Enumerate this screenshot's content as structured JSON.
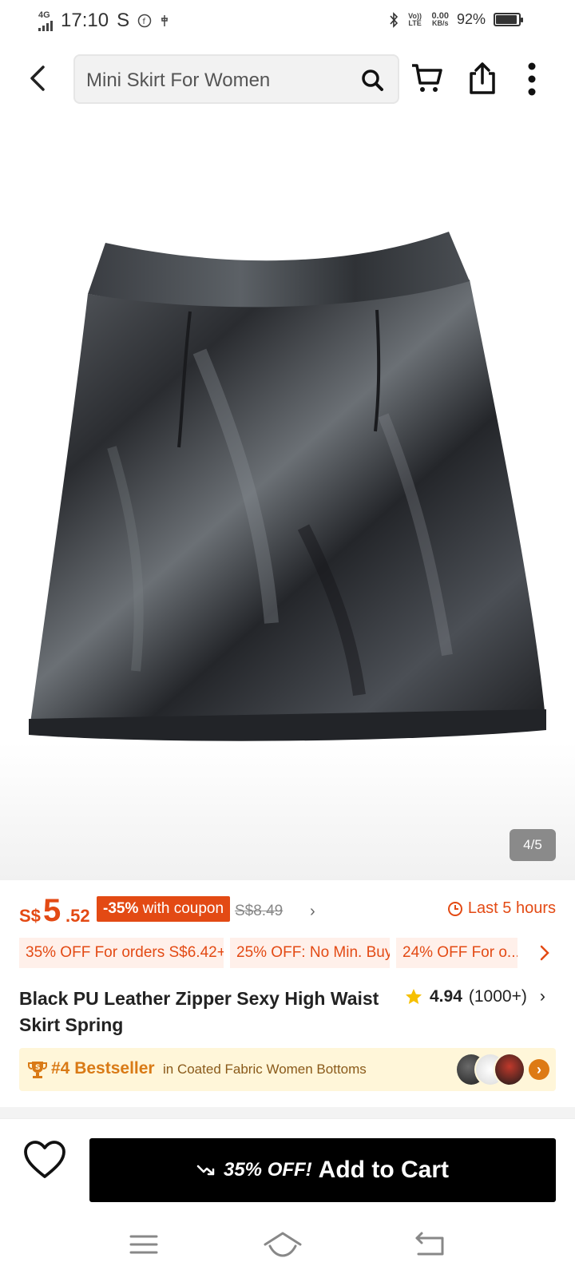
{
  "status_bar": {
    "network": "4G",
    "time": "17:10",
    "carrier_icon": "S",
    "volte": "Vo)) LTE",
    "speed_value": "0.00",
    "speed_unit": "KB/s",
    "battery": "92%",
    "battery_level": 0.92
  },
  "header": {
    "search_text": "Mini Skirt For Women",
    "icons": [
      "back-arrow-icon",
      "search-icon",
      "cart-icon",
      "share-icon",
      "more-vertical-icon"
    ]
  },
  "gallery": {
    "counter": "4/5",
    "current": 4,
    "total": 5
  },
  "price": {
    "currency": "S$",
    "integer": "5",
    "decimal": ".52",
    "coupon_percent": "-35%",
    "coupon_text": "with coupon",
    "original": "S$8.49",
    "timer_label": "Last 5 hours"
  },
  "promos": [
    "35% OFF For orders S$6.42+",
    "25% OFF: No Min. Buy",
    "24% OFF For o..."
  ],
  "product": {
    "title": "Black PU Leather Zipper Sexy High Waist Skirt Spring",
    "rating": "4.94",
    "reviews": "(1000+)"
  },
  "bestseller": {
    "rank": "#4 Bestseller",
    "category": "in Coated Fabric Women Bottoms"
  },
  "cart_bar": {
    "discount": "35% OFF!",
    "button_label": "Add to Cart"
  },
  "colors": {
    "accent": "#e34a14",
    "promo_bg": "#fff0ea",
    "bestseller_bg": "#fff6d9",
    "button_bg": "#000000"
  }
}
